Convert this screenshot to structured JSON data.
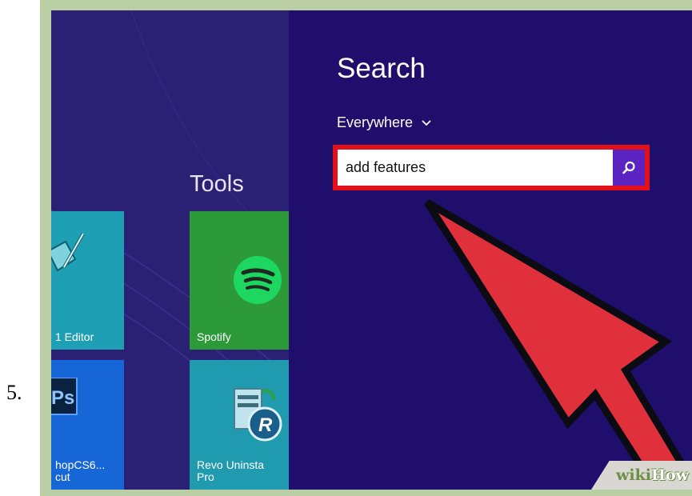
{
  "step": {
    "number": "5."
  },
  "start": {
    "group_title": "Tools",
    "tiles": [
      {
        "label": "1 Editor",
        "icon": "editor-icon",
        "color": "#1f9fb4"
      },
      {
        "label": "hopCS6...\ncut",
        "icon": "photoshop-icon",
        "color": "#1666d8",
        "icon_text": "Ps"
      },
      {
        "label": "Spotify",
        "icon": "spotify-icon",
        "color": "#2d9a3a"
      },
      {
        "label": "Revo Uninsta\nPro",
        "icon": "revo-uninstaller-icon",
        "color": "#1f9aae",
        "icon_text": "R"
      }
    ]
  },
  "search": {
    "title": "Search",
    "scope": "Everywhere",
    "query": "add features",
    "button_icon": "search-icon",
    "highlight_color": "#e3101a",
    "accent": "#5b24c2"
  },
  "annotation": {
    "arrow_color": "#e0303c"
  },
  "watermark": {
    "wiki": "wiki",
    "how": "How"
  }
}
